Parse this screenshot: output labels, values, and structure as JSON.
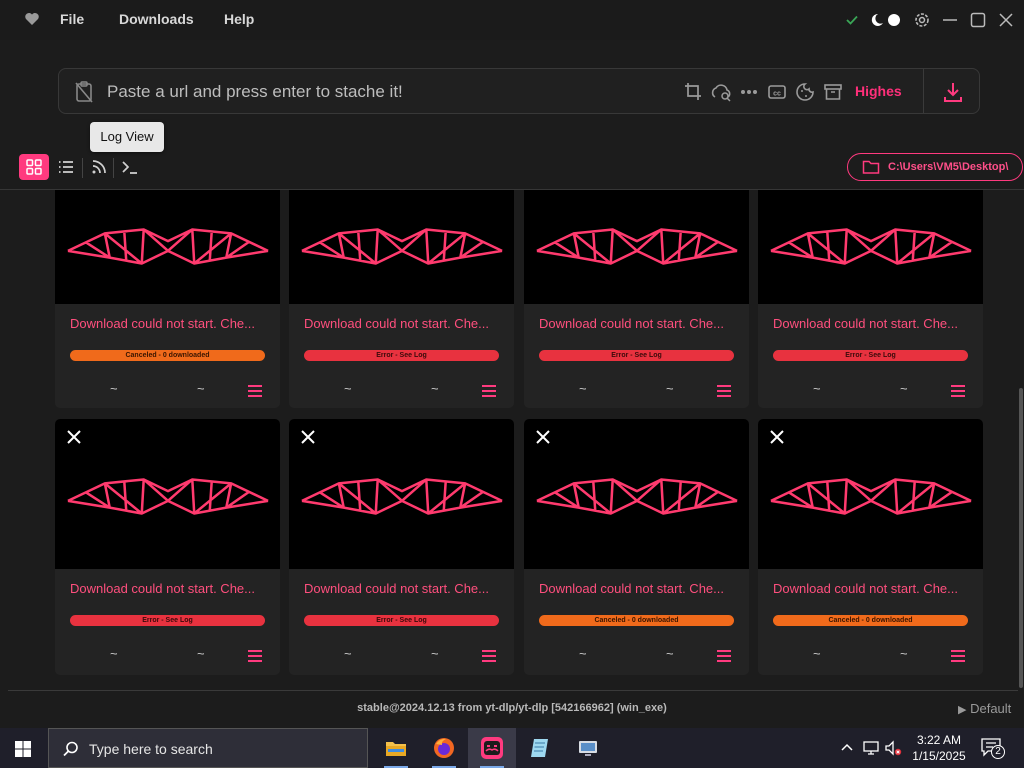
{
  "titlebar": {
    "app_icon": "heart-icon",
    "menu": [
      "File",
      "Downloads",
      "Help"
    ],
    "controls": [
      "check-icon",
      "theme-toggle-icon",
      "gear-icon",
      "minimize-icon",
      "maximize-icon",
      "close-icon"
    ]
  },
  "urlbar": {
    "placeholder": "Paste a url and press enter to stache it!",
    "value": "",
    "quality": "Highes",
    "tools": [
      "crop-icon",
      "cloud-search-icon",
      "more-icon",
      "cc-icon",
      "cookie-icon",
      "archive-icon"
    ]
  },
  "tooltip": {
    "text": "Log View"
  },
  "toolbar": {
    "views": [
      "grid-view-icon",
      "list-view-icon",
      "rss-icon",
      "terminal-icon"
    ],
    "path": "C:\\Users\\VM5\\Desktop\\"
  },
  "cards": [
    {
      "title": "Download could not start. Che...",
      "status": "Canceled - 0 downloaded",
      "status_type": "cancel",
      "left": "~",
      "right": "~",
      "closable": false
    },
    {
      "title": "Download could not start. Che...",
      "status": "Error - See Log",
      "status_type": "error",
      "left": "~",
      "right": "~",
      "closable": false
    },
    {
      "title": "Download could not start. Che...",
      "status": "Error - See Log",
      "status_type": "error",
      "left": "~",
      "right": "~",
      "closable": false
    },
    {
      "title": "Download could not start. Che...",
      "status": "Error - See Log",
      "status_type": "error",
      "left": "~",
      "right": "~",
      "closable": false
    },
    {
      "title": "Download could not start. Che...",
      "status": "Error - See Log",
      "status_type": "error",
      "left": "~",
      "right": "~",
      "closable": true
    },
    {
      "title": "Download could not start. Che...",
      "status": "Error - See Log",
      "status_type": "error",
      "left": "~",
      "right": "~",
      "closable": true
    },
    {
      "title": "Download could not start. Che...",
      "status": "Canceled - 0 downloaded",
      "status_type": "cancel",
      "left": "~",
      "right": "~",
      "closable": true
    },
    {
      "title": "Download could not start. Che...",
      "status": "Canceled - 0 downloaded",
      "status_type": "cancel",
      "left": "~",
      "right": "~",
      "closable": true
    }
  ],
  "footer": {
    "version": "stable@2024.12.13 from yt-dlp/yt-dlp [542166962] (win_exe)",
    "profile": "Default"
  },
  "taskbar": {
    "search_placeholder": "Type here to search",
    "apps": [
      "file-explorer-icon",
      "firefox-icon",
      "app-mustache-icon",
      "notepad-icon",
      "remote-desktop-icon"
    ],
    "time": "3:22 AM",
    "date": "1/15/2025",
    "notifications": "2"
  },
  "colors": {
    "accent": "#ff3a7f",
    "error": "#e8323f",
    "cancel": "#f06a1b",
    "background": "#1c1c1c"
  }
}
